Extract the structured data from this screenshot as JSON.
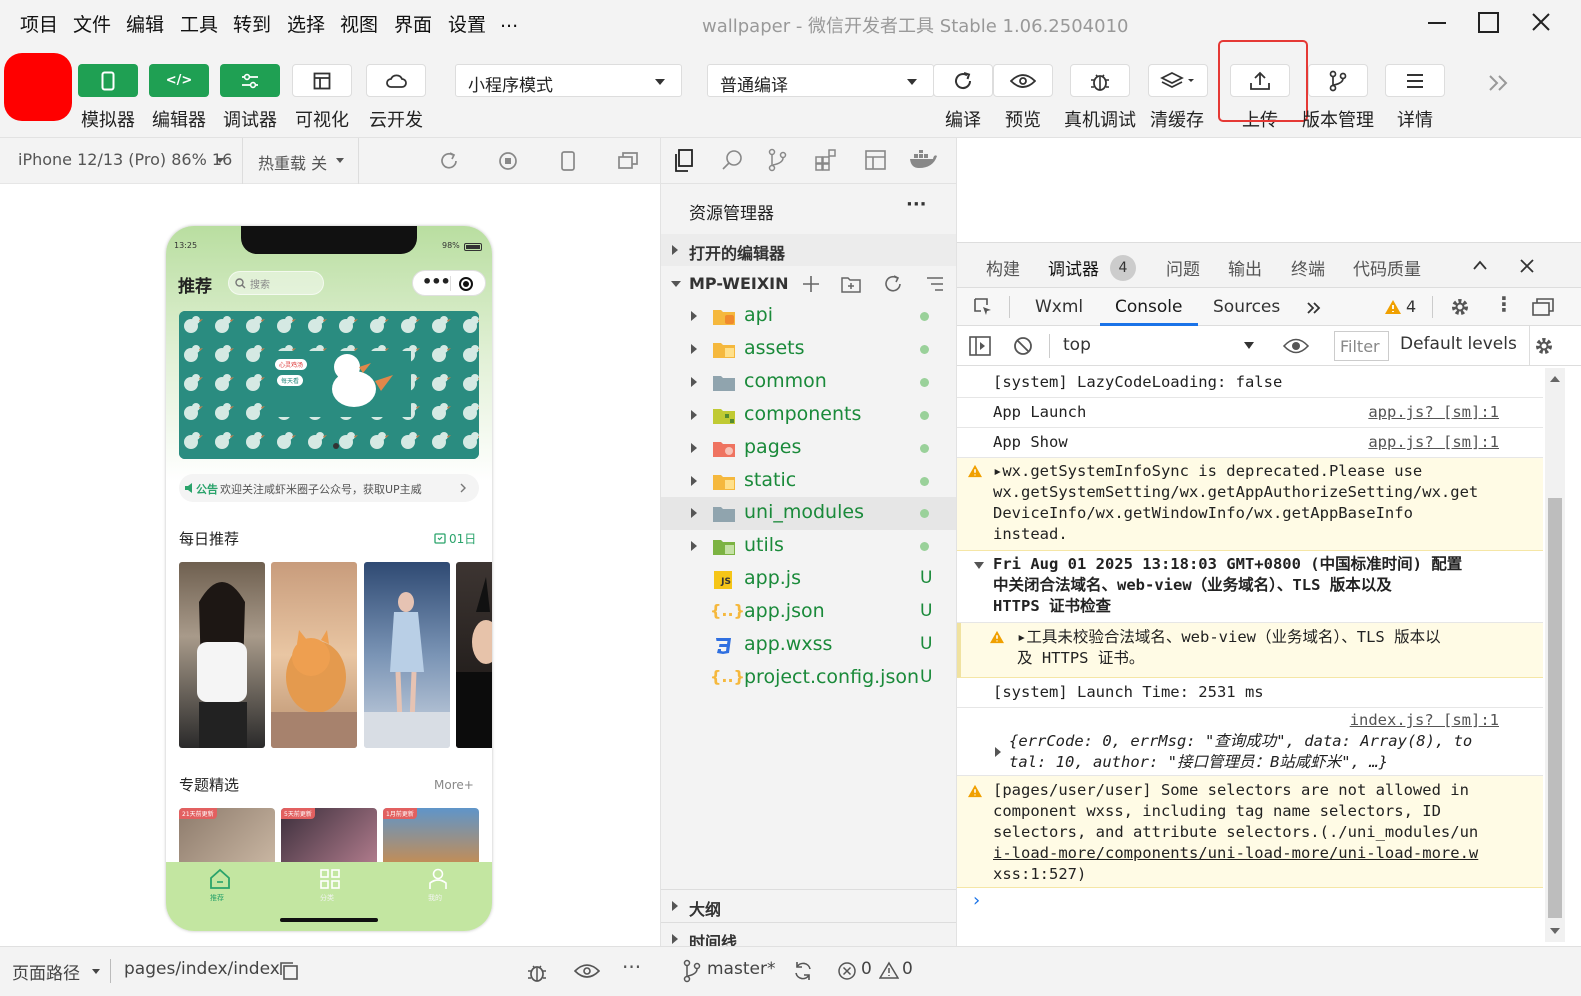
{
  "menu": [
    "项目",
    "文件",
    "编辑",
    "工具",
    "转到",
    "选择",
    "视图",
    "界面",
    "设置",
    "..."
  ],
  "window_title": "wallpaper - 微信开发者工具 Stable 1.06.2504010",
  "toolbar": {
    "left_buttons": [
      "模拟器",
      "编辑器",
      "调试器",
      "可视化",
      "云开发"
    ],
    "mode_select": "小程序模式",
    "compile_select": "普通编译",
    "right_buttons": [
      "编译",
      "预览",
      "真机调试",
      "清缓存",
      "上传",
      "版本管理",
      "详情"
    ]
  },
  "simulator": {
    "device": "iPhone 12/13 (Pro) 86% 16",
    "hot_reload": "热重载 关",
    "phone": {
      "time": "13:25",
      "battery": "98%",
      "nav_title": "推荐",
      "search_placeholder": "搜索",
      "notice_tag": "公告",
      "notice_text": "欢迎关注咸虾米圈子公众号，获取UP主威",
      "daily_title": "每日推荐",
      "daily_date": "01日",
      "topic_title": "专题精选",
      "topic_more": "More+",
      "topic_badges": [
        "21天前更新",
        "5天前更新",
        "1月前更新"
      ],
      "tabs": [
        "推荐",
        "分类",
        "我的"
      ],
      "banner_pills": [
        "心灵鸡汤",
        "每天看"
      ]
    }
  },
  "explorer": {
    "title": "资源管理器",
    "more": "···",
    "open_editors": "打开的编辑器",
    "project": "MP-WEIXIN",
    "folders": [
      "api",
      "assets",
      "common",
      "components",
      "pages",
      "static",
      "uni_modules",
      "utils"
    ],
    "files": [
      {
        "name": "app.js",
        "status": "U"
      },
      {
        "name": "app.json",
        "status": "U"
      },
      {
        "name": "app.wxss",
        "status": "U"
      },
      {
        "name": "project.config.json",
        "status": "U"
      }
    ],
    "outline": "大纲",
    "timeline": "时间线"
  },
  "devtools": {
    "top_tabs": [
      "构建",
      "调试器",
      "问题",
      "输出",
      "终端",
      "代码质量"
    ],
    "debugger_badge": "4",
    "sub_tabs": [
      "Wxml",
      "Console",
      "Sources"
    ],
    "warn_count": "4",
    "context": "top",
    "filter_placeholder": "Filter",
    "levels": "Default levels",
    "logs": {
      "l1": "[system] LazyCodeLoading: false",
      "l2": "App Launch",
      "l2_src": "app.js? [sm]:1",
      "l3": "App Show",
      "l3_src": "app.js? [sm]:1",
      "l4": [
        "▸wx.getSystemInfoSync is deprecated.Please use",
        "wx.getSystemSetting/wx.getAppAuthorizeSetting/wx.get",
        "DeviceInfo/wx.getWindowInfo/wx.getAppBaseInfo",
        "instead."
      ],
      "l5": [
        "Fri Aug 01 2025 13:18:03 GMT+0800 (中国标准时间) 配置",
        "中关闭合法域名、web-view（业务域名）、TLS 版本以及",
        "HTTPS 证书检查"
      ],
      "l6": [
        "▸工具未校验合法域名、web-view（业务域名）、TLS 版本以",
        "及 HTTPS 证书。"
      ],
      "l7": "[system] Launch Time: 2531 ms",
      "l8_src": "index.js? [sm]:1",
      "l8": [
        "{errCode: 0, errMsg: \"查询成功\", data: Array(8), to",
        "tal: 10, author: \"接口管理员：B站咸虾米\", …}"
      ],
      "l9": [
        "[pages/user/user] Some selectors are not allowed in",
        "component wxss, including tag name selectors, ID",
        "selectors, and attribute selectors.(./uni_modules/un",
        "i-load-more/components/uni-load-more/uni-load-more.w",
        "xss:1:527)"
      ]
    },
    "prompt": "›"
  },
  "status": {
    "page_path_label": "页面路径",
    "page_path": "pages/index/index",
    "branch": "master*",
    "errors": "0",
    "warnings": "0"
  },
  "colors": {
    "accent": "#1fa053",
    "highlight": "#e53935",
    "phone_green": "#c3e6a1"
  }
}
